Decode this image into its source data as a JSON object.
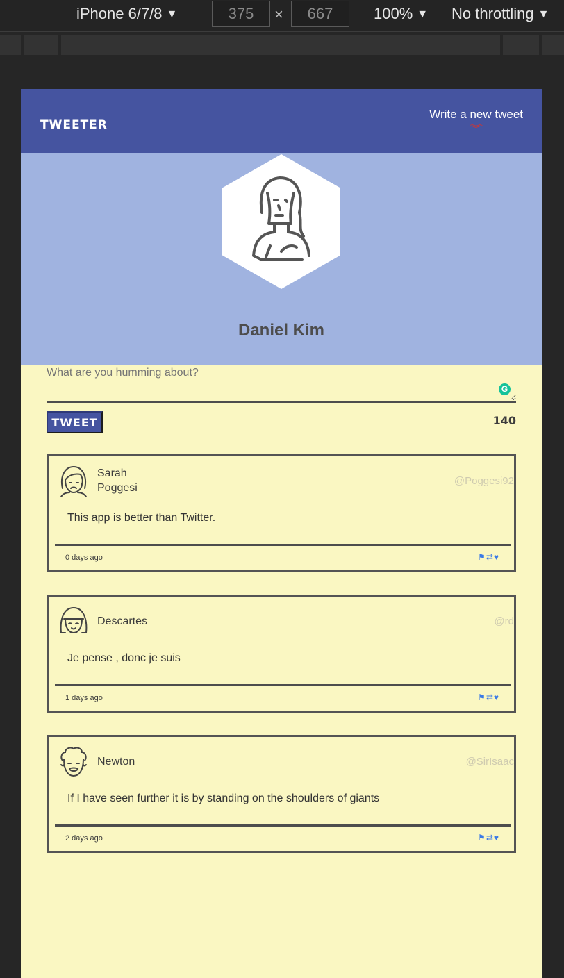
{
  "devtools": {
    "device": "iPhone 6/7/8",
    "width": "375",
    "height": "667",
    "times": "×",
    "zoom": "100%",
    "throttling": "No throttling",
    "caret": "▼"
  },
  "nav": {
    "brand": "TWEETER",
    "compose_label": "Write a new tweet",
    "chevron": "︾"
  },
  "profile": {
    "name": "Daniel Kim"
  },
  "composer": {
    "placeholder": "What are you humming about?",
    "button_label": "TWEET",
    "counter": "140",
    "grammar_badge": "G"
  },
  "tweets": [
    {
      "name_line1": "Sarah",
      "name_line2": "Poggesi",
      "handle": "@Poggesi92",
      "body": "This app is better than Twitter.",
      "timestamp": "0 days ago"
    },
    {
      "name_line1": "Descartes",
      "handle": "@rd",
      "body": "Je pense , donc je suis",
      "timestamp": "1 days ago"
    },
    {
      "name_line1": "Newton",
      "handle": "@SirIsaac",
      "body": "If I have seen further it is by standing on the shoulders of giants",
      "timestamp": "2 days ago"
    }
  ],
  "actions": {
    "flag_icon": "⚑",
    "retweet_icon": "⇄",
    "like_icon": "♥"
  },
  "colors": {
    "navbar": "#4554a0",
    "header": "#a0b3e0",
    "page_bg": "#faf7c2",
    "accent_chevron": "#d8332b",
    "action_blue": "#3a7ae6"
  }
}
